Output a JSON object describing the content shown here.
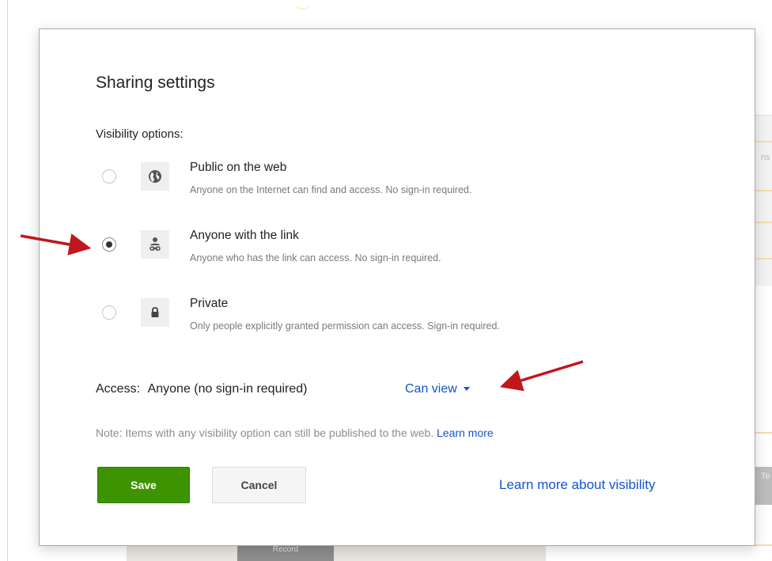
{
  "background": {
    "right_fragment": "ns",
    "right_tab_fragment": "Te",
    "bottom_button_text": "Record"
  },
  "dialog": {
    "title": "Sharing settings",
    "visibility_label": "Visibility options:",
    "options": [
      {
        "title": "Public on the web",
        "description": "Anyone on the Internet can find and access. No sign-in required.",
        "icon": "globe-icon",
        "selected": false
      },
      {
        "title": "Anyone with the link",
        "description": "Anyone who has the link can access. No sign-in required.",
        "icon": "person-link-icon",
        "selected": true
      },
      {
        "title": "Private",
        "description": "Only people explicitly granted permission can access. Sign-in required.",
        "icon": "lock-icon",
        "selected": false
      }
    ],
    "access": {
      "label": "Access:",
      "value": "Anyone (no sign-in required)",
      "permission": "Can view"
    },
    "note": {
      "text": "Note: Items with any visibility option can still be published to the web.",
      "link": "Learn more"
    },
    "buttons": {
      "save": "Save",
      "cancel": "Cancel"
    },
    "learn_more_visibility": "Learn more about visibility"
  },
  "colors": {
    "link": "#1155cc",
    "save_button": "#3d9400",
    "annotation_arrow": "#c0161d"
  }
}
